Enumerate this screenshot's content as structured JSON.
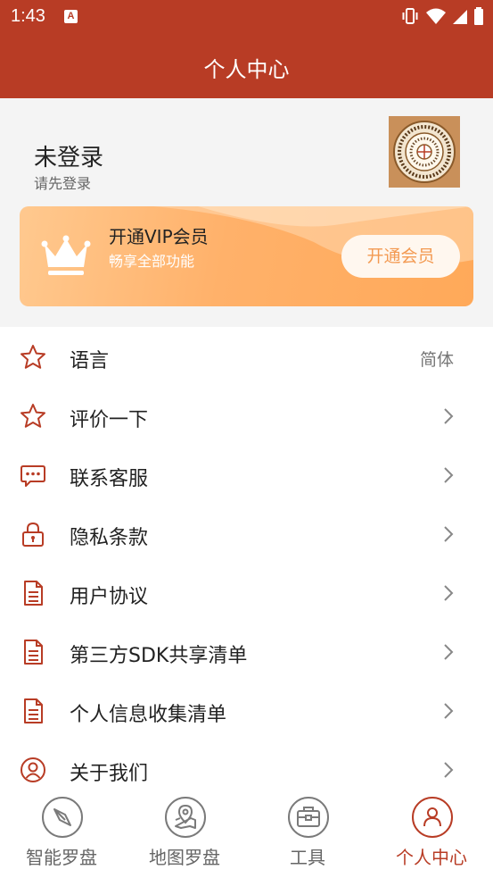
{
  "status_bar": {
    "time": "1:43",
    "notification_badge": "A"
  },
  "header": {
    "title": "个人中心"
  },
  "profile": {
    "name": "未登录",
    "subtitle": "请先登录"
  },
  "vip": {
    "title": "开通VIP会员",
    "subtitle": "畅享全部功能",
    "button_label": "开通会员"
  },
  "menu": {
    "items": [
      {
        "label": "语言",
        "value": "简体",
        "icon": "star-icon"
      },
      {
        "label": "评价一下",
        "icon": "star-icon"
      },
      {
        "label": "联系客服",
        "icon": "chat-icon"
      },
      {
        "label": "隐私条款",
        "icon": "lock-icon"
      },
      {
        "label": "用户协议",
        "icon": "document-icon"
      },
      {
        "label": "第三方SDK共享清单",
        "icon": "document-icon"
      },
      {
        "label": "个人信息收集清单",
        "icon": "document-icon"
      },
      {
        "label": "关于我们",
        "icon": "user-icon"
      }
    ]
  },
  "bottom_nav": {
    "items": [
      {
        "label": "智能罗盘",
        "icon": "compass-icon"
      },
      {
        "label": "地图罗盘",
        "icon": "map-pin-icon"
      },
      {
        "label": "工具",
        "icon": "toolbox-icon"
      },
      {
        "label": "个人中心",
        "icon": "user-icon",
        "active": true
      }
    ]
  },
  "colors": {
    "primary": "#b83c25",
    "vip_gradient_start": "#ffc98f",
    "vip_gradient_end": "#ffa959",
    "vip_button_text": "#f39a52"
  }
}
